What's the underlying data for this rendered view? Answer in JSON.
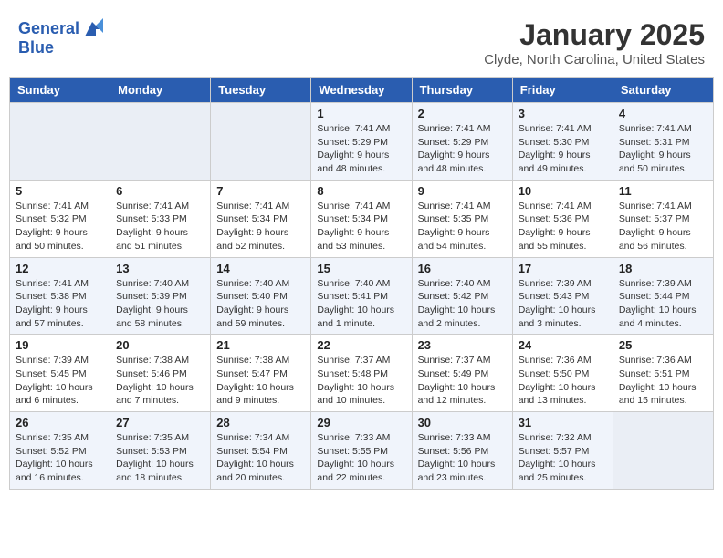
{
  "header": {
    "logo_line1": "General",
    "logo_line2": "Blue",
    "month": "January 2025",
    "location": "Clyde, North Carolina, United States"
  },
  "weekdays": [
    "Sunday",
    "Monday",
    "Tuesday",
    "Wednesday",
    "Thursday",
    "Friday",
    "Saturday"
  ],
  "weeks": [
    [
      {
        "day": "",
        "info": ""
      },
      {
        "day": "",
        "info": ""
      },
      {
        "day": "",
        "info": ""
      },
      {
        "day": "1",
        "info": "Sunrise: 7:41 AM\nSunset: 5:29 PM\nDaylight: 9 hours and 48 minutes."
      },
      {
        "day": "2",
        "info": "Sunrise: 7:41 AM\nSunset: 5:29 PM\nDaylight: 9 hours and 48 minutes."
      },
      {
        "day": "3",
        "info": "Sunrise: 7:41 AM\nSunset: 5:30 PM\nDaylight: 9 hours and 49 minutes."
      },
      {
        "day": "4",
        "info": "Sunrise: 7:41 AM\nSunset: 5:31 PM\nDaylight: 9 hours and 50 minutes."
      }
    ],
    [
      {
        "day": "5",
        "info": "Sunrise: 7:41 AM\nSunset: 5:32 PM\nDaylight: 9 hours and 50 minutes."
      },
      {
        "day": "6",
        "info": "Sunrise: 7:41 AM\nSunset: 5:33 PM\nDaylight: 9 hours and 51 minutes."
      },
      {
        "day": "7",
        "info": "Sunrise: 7:41 AM\nSunset: 5:34 PM\nDaylight: 9 hours and 52 minutes."
      },
      {
        "day": "8",
        "info": "Sunrise: 7:41 AM\nSunset: 5:34 PM\nDaylight: 9 hours and 53 minutes."
      },
      {
        "day": "9",
        "info": "Sunrise: 7:41 AM\nSunset: 5:35 PM\nDaylight: 9 hours and 54 minutes."
      },
      {
        "day": "10",
        "info": "Sunrise: 7:41 AM\nSunset: 5:36 PM\nDaylight: 9 hours and 55 minutes."
      },
      {
        "day": "11",
        "info": "Sunrise: 7:41 AM\nSunset: 5:37 PM\nDaylight: 9 hours and 56 minutes."
      }
    ],
    [
      {
        "day": "12",
        "info": "Sunrise: 7:41 AM\nSunset: 5:38 PM\nDaylight: 9 hours and 57 minutes."
      },
      {
        "day": "13",
        "info": "Sunrise: 7:40 AM\nSunset: 5:39 PM\nDaylight: 9 hours and 58 minutes."
      },
      {
        "day": "14",
        "info": "Sunrise: 7:40 AM\nSunset: 5:40 PM\nDaylight: 9 hours and 59 minutes."
      },
      {
        "day": "15",
        "info": "Sunrise: 7:40 AM\nSunset: 5:41 PM\nDaylight: 10 hours and 1 minute."
      },
      {
        "day": "16",
        "info": "Sunrise: 7:40 AM\nSunset: 5:42 PM\nDaylight: 10 hours and 2 minutes."
      },
      {
        "day": "17",
        "info": "Sunrise: 7:39 AM\nSunset: 5:43 PM\nDaylight: 10 hours and 3 minutes."
      },
      {
        "day": "18",
        "info": "Sunrise: 7:39 AM\nSunset: 5:44 PM\nDaylight: 10 hours and 4 minutes."
      }
    ],
    [
      {
        "day": "19",
        "info": "Sunrise: 7:39 AM\nSunset: 5:45 PM\nDaylight: 10 hours and 6 minutes."
      },
      {
        "day": "20",
        "info": "Sunrise: 7:38 AM\nSunset: 5:46 PM\nDaylight: 10 hours and 7 minutes."
      },
      {
        "day": "21",
        "info": "Sunrise: 7:38 AM\nSunset: 5:47 PM\nDaylight: 10 hours and 9 minutes."
      },
      {
        "day": "22",
        "info": "Sunrise: 7:37 AM\nSunset: 5:48 PM\nDaylight: 10 hours and 10 minutes."
      },
      {
        "day": "23",
        "info": "Sunrise: 7:37 AM\nSunset: 5:49 PM\nDaylight: 10 hours and 12 minutes."
      },
      {
        "day": "24",
        "info": "Sunrise: 7:36 AM\nSunset: 5:50 PM\nDaylight: 10 hours and 13 minutes."
      },
      {
        "day": "25",
        "info": "Sunrise: 7:36 AM\nSunset: 5:51 PM\nDaylight: 10 hours and 15 minutes."
      }
    ],
    [
      {
        "day": "26",
        "info": "Sunrise: 7:35 AM\nSunset: 5:52 PM\nDaylight: 10 hours and 16 minutes."
      },
      {
        "day": "27",
        "info": "Sunrise: 7:35 AM\nSunset: 5:53 PM\nDaylight: 10 hours and 18 minutes."
      },
      {
        "day": "28",
        "info": "Sunrise: 7:34 AM\nSunset: 5:54 PM\nDaylight: 10 hours and 20 minutes."
      },
      {
        "day": "29",
        "info": "Sunrise: 7:33 AM\nSunset: 5:55 PM\nDaylight: 10 hours and 22 minutes."
      },
      {
        "day": "30",
        "info": "Sunrise: 7:33 AM\nSunset: 5:56 PM\nDaylight: 10 hours and 23 minutes."
      },
      {
        "day": "31",
        "info": "Sunrise: 7:32 AM\nSunset: 5:57 PM\nDaylight: 10 hours and 25 minutes."
      },
      {
        "day": "",
        "info": ""
      }
    ]
  ]
}
